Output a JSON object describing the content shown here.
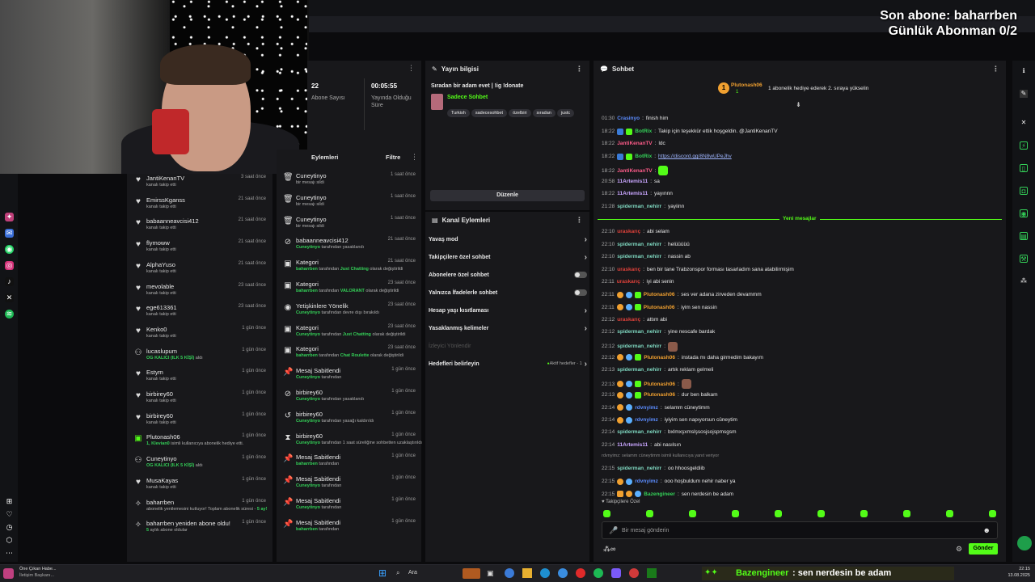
{
  "overlay": {
    "last_sub": "Son abone: baharrben",
    "daily_goal": "Günlük Abonman 0/2"
  },
  "stats": {
    "sub_count": "22",
    "sub_label": "Abone Sayısı",
    "uptime": "00:05:55",
    "uptime_label": "Yayında Olduğu Süre"
  },
  "activity": [
    {
      "name": "JantiKenanTV",
      "sub": "kanalı takip etti",
      "time": "3 saat önce",
      "icon": "heart"
    },
    {
      "name": "EmirssKganss",
      "sub": "kanalı takip etti",
      "time": "21 saat önce",
      "icon": "heart"
    },
    {
      "name": "babaanneavcisi412",
      "sub": "kanalı takip etti",
      "time": "21 saat önce",
      "icon": "heart"
    },
    {
      "name": "flymoww",
      "sub": "kanalı takip etti",
      "time": "21 saat önce",
      "icon": "heart"
    },
    {
      "name": "AlphaYuso",
      "sub": "kanalı takip etti",
      "time": "21 saat önce",
      "icon": "heart"
    },
    {
      "name": "mevolable",
      "sub": "kanalı takip etti",
      "time": "23 saat önce",
      "icon": "heart"
    },
    {
      "name": "ege613361",
      "sub": "kanalı takip etti",
      "time": "23 saat önce",
      "icon": "heart"
    },
    {
      "name": "Kenko0",
      "sub": "kanalı takip etti",
      "time": "1 gün önce",
      "icon": "heart"
    },
    {
      "name": "lucaslupum",
      "sub_hl": "OG KALICI (ILK 5 KİŞİ)",
      "sub": " aldı",
      "time": "1 gün önce",
      "icon": "redeem"
    },
    {
      "name": "Estym",
      "sub": "kanalı takip etti",
      "time": "1 gün önce",
      "icon": "heart"
    },
    {
      "name": "birbirey60",
      "sub": "kanalı takip etti",
      "time": "1 gün önce",
      "icon": "heart"
    },
    {
      "name": "birbirey60",
      "sub": "kanalı takip etti",
      "time": "1 gün önce",
      "icon": "heart"
    },
    {
      "name": "Plutonash06",
      "sub_hl": "1, Klevian0",
      "sub": " isimli kullanıcıya abonelik hediye etti.",
      "time": "1 gün önce",
      "icon": "gift"
    },
    {
      "name": "Cuneytinyo",
      "sub_hl": "OG KALICI (ILK 5 KİŞİ)",
      "sub": " aldı",
      "time": "1 gün önce",
      "icon": "redeem"
    },
    {
      "name": "MusaKayas",
      "sub": "kanalı takip etti",
      "time": "1 gün önce",
      "icon": "heart"
    },
    {
      "name": "baharrben",
      "sub": "abonelik yenilemesini kutluyor! Toplam abonelik süresi -",
      "sub_hl": " 5 ay!",
      "time": "1 gün önce",
      "icon": "star"
    },
    {
      "name": "baharrben yeniden abone oldu!",
      "sub_hl": "5",
      "sub": " aylık abone oldular",
      "time": "1 gün önce",
      "icon": "star"
    }
  ],
  "mod_log": {
    "title": "Eylemleri",
    "filter": "Filtre",
    "items": [
      {
        "name": "Cuneytinyo",
        "sub": "bir mesajı sildi",
        "time": "1 saat önce",
        "icon": "trash"
      },
      {
        "name": "Cuneytinyo",
        "sub": "bir mesajı sildi",
        "time": "1 saat önce",
        "icon": "trash"
      },
      {
        "name": "Cuneytinyo",
        "sub": "bir mesajı sildi",
        "time": "1 saat önce",
        "icon": "trash"
      },
      {
        "name": "babaanneavcisi412",
        "hl": "Cuneytinyo",
        "sub": " tarafından yasaklandı",
        "time": "21 saat önce",
        "icon": "ban"
      },
      {
        "name": "Kategori",
        "hl": "baharrben",
        "sub": " tarafından ",
        "hl2": "Just Chatting",
        "sub2": " olarak değiştirildi",
        "time": "21 saat önce",
        "icon": "cat"
      },
      {
        "name": "Kategori",
        "hl": "baharrben",
        "sub": " tarafından ",
        "hl2": "VALORANT",
        "sub2": " olarak değiştirildi",
        "time": "23 saat önce",
        "icon": "cat"
      },
      {
        "name": "Yetişkinlere Yönelik",
        "hl": "Cuneytinyo",
        "sub": " tarafından devre dışı bırakıldı",
        "time": "23 saat önce",
        "icon": "eye"
      },
      {
        "name": "Kategori",
        "hl": "Cuneytinyo",
        "sub": " tarafından ",
        "hl2": "Just Chatting",
        "sub2": " olarak değiştirildi",
        "time": "23 saat önce",
        "icon": "cat"
      },
      {
        "name": "Kategori",
        "hl": "baharrben",
        "sub": " tarafından ",
        "hl2": "Chat Roulette",
        "sub2": " olarak değiştirildi",
        "time": "23 saat önce",
        "icon": "cat"
      },
      {
        "name": "Mesaj Sabitlendi",
        "hl": "Cuneytinyo",
        "sub": " tarafından",
        "time": "1 gün önce",
        "icon": "pin"
      },
      {
        "name": "birbirey60",
        "hl": "Cuneytinyo",
        "sub": " tarafından yasaklandı",
        "time": "1 gün önce",
        "icon": "ban"
      },
      {
        "name": "birbirey60",
        "hl": "Cuneytinyo",
        "sub": " tarafından yasağı kaldırıldı",
        "time": "1 gün önce",
        "icon": "unban"
      },
      {
        "name": "birbirey60",
        "hl": "Cuneytinyo",
        "sub": " tarafından 1 saat süreliğine sohbetten uzaklaştırıldı",
        "time": "1 gün önce",
        "icon": "timer"
      },
      {
        "name": "Mesaj Sabitlendi",
        "hl": "baharrben",
        "sub": " tarafından",
        "time": "1 gün önce",
        "icon": "pin"
      },
      {
        "name": "Mesaj Sabitlendi",
        "hl": "Cuneytinyo",
        "sub": " tarafından",
        "time": "1 gün önce",
        "icon": "pin"
      },
      {
        "name": "Mesaj Sabitlendi",
        "hl": "Cuneytinyo",
        "sub": " tarafından",
        "time": "1 gün önce",
        "icon": "pin"
      },
      {
        "name": "Mesaj Sabitlendi",
        "hl": "baharrben",
        "sub": " tarafından",
        "time": "1 gün önce",
        "icon": "pin"
      }
    ]
  },
  "stream_info": {
    "header": "Yayın bilgisi",
    "title": "Sıradan bir adam evet | !ig !donate",
    "category": "Sadece Sohbet",
    "tags": [
      "Turkish",
      "sadecesohbet",
      "özelbiri",
      "sıradan",
      "justc"
    ],
    "edit": "Düzenle"
  },
  "channel_actions": {
    "header": "Kanal Eylemleri",
    "items": [
      {
        "label": "Yavaş mod",
        "kind": "chevron"
      },
      {
        "label": "Takipçilere özel sohbet",
        "kind": "chevron"
      },
      {
        "label": "Abonelere özel sohbet",
        "kind": "toggle"
      },
      {
        "label": "Yalnızca İfadelerle sohbet",
        "kind": "toggle"
      },
      {
        "label": "Hesap yaşı kısıtlaması",
        "kind": "chevron"
      },
      {
        "label": "Yasaklanmış kelimeler",
        "kind": "chevron"
      },
      {
        "label": "İzleyici Yönlendir",
        "kind": "disabled"
      },
      {
        "label": "Hedefleri belirleyin",
        "kind": "goal",
        "status": "Aktif hedefler - 1"
      }
    ]
  },
  "chat": {
    "header": "Sohbet",
    "pinned_user": "Plutonash06",
    "pinned_count": "1",
    "pinned_text": "1 abonelik hediye ederek 2. sıraya yükselin",
    "new_messages": "Yeni mesajlar",
    "reply_hint": "rdvnyimz: selamm cüneytimm isimli kullanıcıya yanıt veriyor",
    "followers_only": "Takipçilere Özel",
    "input_placeholder": "Bir mesaj gönderin",
    "send": "Gönder",
    "messages": [
      {
        "t": "01:30",
        "u": "Crasinyo",
        "c": "#5b8cff",
        "m": "finish him"
      },
      {
        "t": "18:22",
        "u": "BotRix",
        "c": "#34d058",
        "m": "Takip için teşekkür ettik hoşgeldin. @JantiKenanTV",
        "badges": [
          "bot",
          "ver"
        ]
      },
      {
        "t": "18:22",
        "u": "JantiKenanTV",
        "c": "#ff5c8a",
        "m": "ldc"
      },
      {
        "t": "18:22",
        "u": "BotRix",
        "c": "#34d058",
        "m": "https://discord.gg/8N8wUPeJhv",
        "link": true,
        "badges": [
          "bot",
          "ver"
        ]
      },
      {
        "t": "18:22",
        "u": "JantiKenanTV",
        "c": "#ff5c8a",
        "m": "",
        "emote": true
      },
      {
        "t": "20:58",
        "u": "11Artemis11",
        "c": "#c9a6ff",
        "m": "sa"
      },
      {
        "t": "18:22",
        "u": "11Artemis11",
        "c": "#c9a6ff",
        "m": "yayınnn"
      },
      {
        "t": "21:28",
        "u": "spiderman_nehirr",
        "c": "#7fd8c0",
        "m": "yayiinn"
      },
      {
        "t": "22:10",
        "u": "uraskarıç",
        "c": "#e0413a",
        "m": "abi selam",
        "new": true
      },
      {
        "t": "22:10",
        "u": "spiderman_nehirr",
        "c": "#7fd8c0",
        "m": "helüüüüü"
      },
      {
        "t": "22:10",
        "u": "spiderman_nehirr",
        "c": "#7fd8c0",
        "m": "nassin ab"
      },
      {
        "t": "22:10",
        "u": "uraskarıç",
        "c": "#e0413a",
        "m": "ben bir tane Trabzonspor forması tasarladım sana atabilirmişim"
      },
      {
        "t": "22:11",
        "u": "uraskarıç",
        "c": "#e0413a",
        "m": "iyi abi senin"
      },
      {
        "t": "22:11",
        "u": "Plutonash06",
        "c": "#f0a030",
        "m": "ses ver adana zirveden devammm",
        "badges": [
          "sub",
          "drop",
          "gift"
        ]
      },
      {
        "t": "22:11",
        "u": "Plutonash06",
        "c": "#f0a030",
        "m": "iyim sen nassin",
        "badges": [
          "sub",
          "drop",
          "gift"
        ]
      },
      {
        "t": "22:12",
        "u": "uraskarıç",
        "c": "#e0413a",
        "m": "attım abi"
      },
      {
        "t": "22:12",
        "u": "spiderman_nehirr",
        "c": "#7fd8c0",
        "m": "yine nescafe bardak"
      },
      {
        "t": "22:12",
        "u": "spiderman_nehirr",
        "c": "#7fd8c0",
        "m": "",
        "emote": true
      },
      {
        "t": "22:12",
        "u": "Plutonash06",
        "c": "#f0a030",
        "m": "instada mı daha girmedim bakayım",
        "badges": [
          "sub",
          "drop",
          "gift"
        ]
      },
      {
        "t": "22:13",
        "u": "spiderman_nehirr",
        "c": "#7fd8c0",
        "m": "artık reklam gelmeli"
      },
      {
        "t": "22:13",
        "u": "Plutonash06",
        "c": "#f0a030",
        "m": "",
        "emote": true,
        "badges": [
          "sub",
          "drop",
          "gift"
        ]
      },
      {
        "t": "22:13",
        "u": "Plutonash06",
        "c": "#f0a030",
        "m": "dur ben balkam",
        "badges": [
          "sub",
          "drop",
          "gift"
        ]
      },
      {
        "t": "22:14",
        "u": "rdvnyimz",
        "c": "#5b8cff",
        "m": "selamm cüneytimm",
        "badges": [
          "sub",
          "drop"
        ]
      },
      {
        "t": "22:14",
        "u": "rdvnyimz",
        "c": "#5b8cff",
        "m": "iyiyim sen napıyorsun cüneytim",
        "badges": [
          "sub",
          "drop"
        ]
      },
      {
        "t": "22:14",
        "u": "spiderman_nehirr",
        "c": "#7fd8c0",
        "m": "bxlmxşxmslşsosjsojspmsgsm"
      },
      {
        "t": "22:14",
        "u": "11Artemis11",
        "c": "#c9a6ff",
        "m": "abi nasılsın"
      },
      {
        "t": "22:15",
        "u": "spiderman_nehirr",
        "c": "#7fd8c0",
        "m": "oo hhoosgeldiib",
        "reply": true
      },
      {
        "t": "22:15",
        "u": "rdvnyimz",
        "c": "#5b8cff",
        "m": "ooo hoşbuldum nehir naber ya",
        "badges": [
          "sub",
          "drop"
        ]
      },
      {
        "t": "22:15",
        "u": "Bazengineer",
        "c": "#34d058",
        "m": "sen nerdesin be adam",
        "badges": [
          "crown",
          "sub",
          "drop"
        ]
      }
    ]
  },
  "taskbar": {
    "weather_title": "Öne Çıkan Habe...",
    "weather_sub": "İletişim Başkanı...",
    "search": "Ara",
    "ticker_user": "Bazengineer",
    "ticker_msg": ": sen nerdesin be adam",
    "clock": "22:15",
    "date": "13.08.2025"
  },
  "colors": {
    "accent": "#53fc18",
    "bg": "#0b0b0d",
    "panel": "#18181b"
  }
}
